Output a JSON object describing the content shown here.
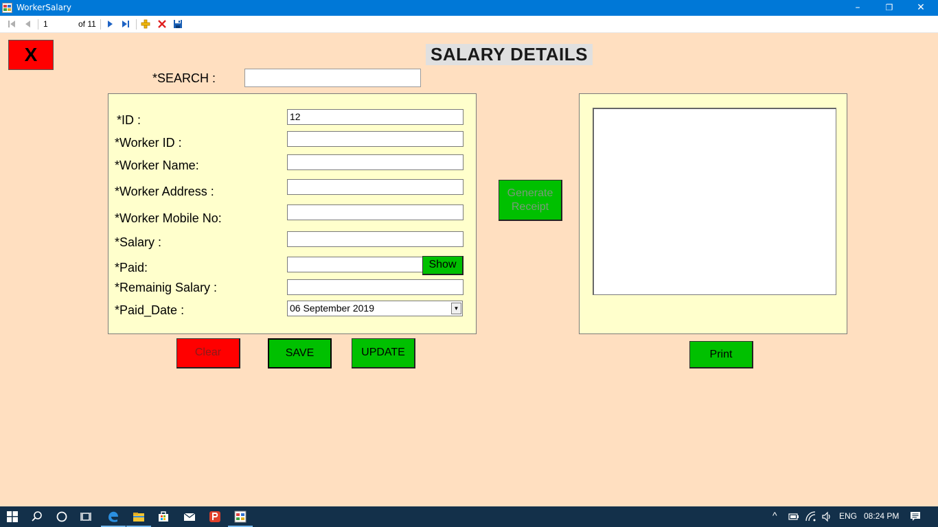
{
  "window": {
    "title": "WorkerSalary",
    "minimize": "–",
    "restore": "❐",
    "close": "✕"
  },
  "navigator": {
    "position": "1",
    "count": "of 11",
    "icons": [
      "move-first-icon",
      "move-previous-icon",
      "move-next-icon",
      "move-last-icon",
      "add-new-icon",
      "delete-icon",
      "save-icon"
    ]
  },
  "form": {
    "close_label": "X",
    "title": "SALARY DETAILS",
    "search_label": "*SEARCH :",
    "search_value": ""
  },
  "fields": {
    "id": {
      "label": "*ID :",
      "value": "12"
    },
    "worker_id": {
      "label": "*Worker ID :",
      "value": ""
    },
    "worker_name": {
      "label": "*Worker Name:",
      "value": ""
    },
    "worker_address": {
      "label": "*Worker Address :",
      "value": ""
    },
    "worker_mobile": {
      "label": "*Worker Mobile No:",
      "value": ""
    },
    "salary": {
      "label": "*Salary :",
      "value": ""
    },
    "paid": {
      "label": "*Paid:",
      "value": ""
    },
    "remaining_salary": {
      "label": "*Remainig Salary :",
      "value": ""
    },
    "paid_date": {
      "label": "*Paid_Date :",
      "value": "06 September 2019"
    }
  },
  "buttons": {
    "show": "Show",
    "generate_receipt": "Generate Receipt",
    "clear": "Clear",
    "save": "SAVE",
    "update": "UPDATE",
    "print": "Print"
  },
  "taskbar": {
    "language": "ENG",
    "time": "08:24 PM"
  },
  "colors": {
    "background": "#FFDFC0",
    "panel": "#FFFFCC",
    "green_button": "#00C000",
    "red_button": "#FF0000",
    "titlebar": "#0078D7",
    "taskbar": "#13304A"
  }
}
